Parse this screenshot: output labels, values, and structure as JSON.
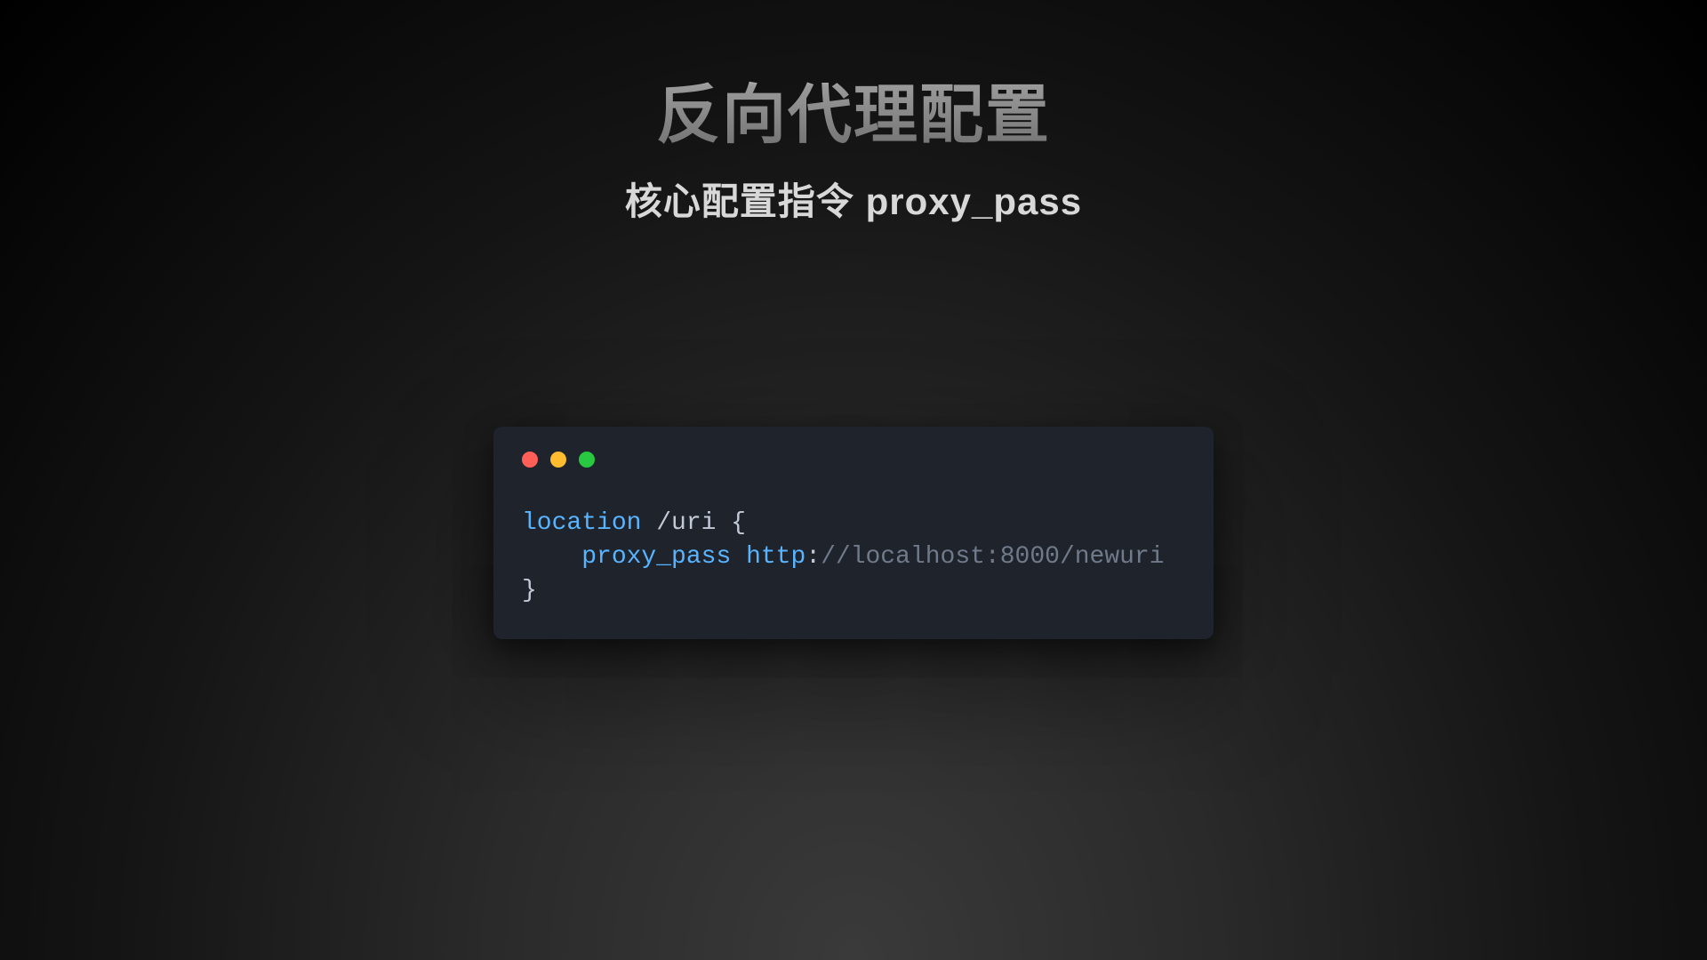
{
  "title": "反向代理配置",
  "subtitle": "核心配置指令 proxy_pass",
  "code": {
    "kw_location": "location",
    "path_uri": " /uri ",
    "brace_open": "{",
    "indent": "    ",
    "kw_proxy_pass": "proxy_pass",
    "space": " ",
    "kw_http": "http",
    "colon": ":",
    "rest_url": "//localhost:8000/newuri",
    "brace_close": "}"
  }
}
